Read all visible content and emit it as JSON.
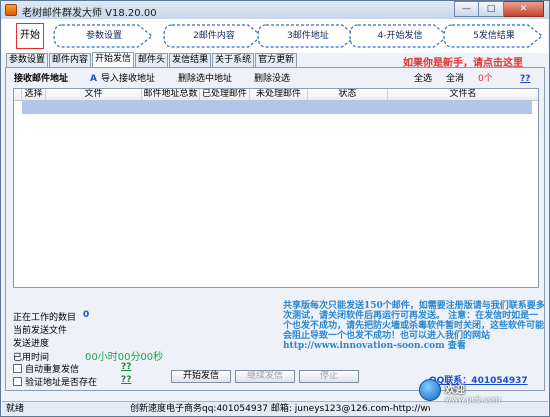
{
  "window": {
    "title": "老树邮件群发大师 V18.20.00",
    "minimize": "—",
    "maximize": "□",
    "close": "✕"
  },
  "flow": {
    "start": "开始",
    "steps": [
      "参数设置",
      "2邮件内容",
      "3邮件地址",
      "4-开始发信",
      "5发信结果"
    ]
  },
  "tabs": [
    "参数设置",
    "邮件内容",
    "开始发信",
    "邮件头",
    "发信结果",
    "关于系统",
    "官方更新"
  ],
  "active_tab": 2,
  "new_user_link": "如果你是新手，请点击这里",
  "toolbar": {
    "receive_label": "接收邮件地址",
    "import_button": "导入接收地址",
    "delete_selected": "删除选中地址",
    "delete_unselected": "删除没选",
    "select_all": "全选",
    "clear_all": "全消",
    "count": "0个",
    "help": "??"
  },
  "table": {
    "columns": [
      "选择",
      "文件",
      "邮件地址总数",
      "已处理邮件",
      "未处理邮件",
      "状态",
      "文件名"
    ]
  },
  "status_panel": {
    "working_count_label": "正在工作的数目",
    "working_count_value": "0",
    "current_file_label": "当前发送文件",
    "progress_label": "发送进度",
    "elapsed_label": "已用时间",
    "elapsed_value": "00小时00分00秒",
    "auto_resend_label": "自动重复发信",
    "auto_resend_help": "??",
    "verify_label": "验证地址是否存在",
    "verify_help": "??"
  },
  "buttons": {
    "start_send": "开始发信",
    "continue_send": "继续发信",
    "stop": "停止"
  },
  "notice": "共享版每次只能发送150个邮件，如需要注册版请与我们联系要多次测试，请关闭软件后再运行可再发送。 注意：在发信时如是一个也发不成功，请先把防火墙或杀毒软件暂时关闭，这些软件可能会阻止导致一个也发不成功！也可以进入我们的网站 http://www.innovation-soon.com 查看",
  "qq": "QQ联系：401054937",
  "statusbar": {
    "state": "就绪",
    "company": "创新速度电子商务qq:401054937 邮箱: juneys123@126.com-http://www.innovation-"
  },
  "watermark": {
    "title": "欢迎",
    "subtitle": "www.pc6.com"
  },
  "colors": {
    "accent_red": "#e0302e",
    "link_blue": "#1b4cd4",
    "notice_blue": "#2a86cf",
    "timer_green": "#1ea44b",
    "selected_row": "#b1c6e8"
  }
}
